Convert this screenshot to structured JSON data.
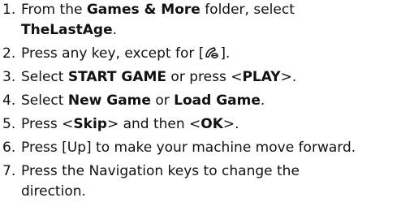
{
  "steps": [
    {
      "number": "1.",
      "line1_pre": "From the ",
      "line1_bold": "Games & More",
      "line1_post": " folder, select",
      "line2_bold": "TheLastAge",
      "line2_post": "."
    },
    {
      "number": "2.",
      "pre": "Press any key, except for [",
      "icon": "end-call-icon",
      "post": "]."
    },
    {
      "number": "3.",
      "pre": "Select ",
      "bold1": "START GAME",
      "mid": " or press <",
      "bold2": "PLAY",
      "post": ">."
    },
    {
      "number": "4.",
      "pre": "Select ",
      "bold1": "New Game",
      "mid": " or ",
      "bold2": "Load Game",
      "post": "."
    },
    {
      "number": "5.",
      "pre": "Press <",
      "bold1": "Skip",
      "mid": "> and then <",
      "bold2": "OK",
      "post": ">."
    },
    {
      "number": "6.",
      "text": "Press [Up] to make your machine move forward."
    },
    {
      "number": "7.",
      "line1": "Press the Navigation keys to change the",
      "line2": "direction."
    }
  ]
}
